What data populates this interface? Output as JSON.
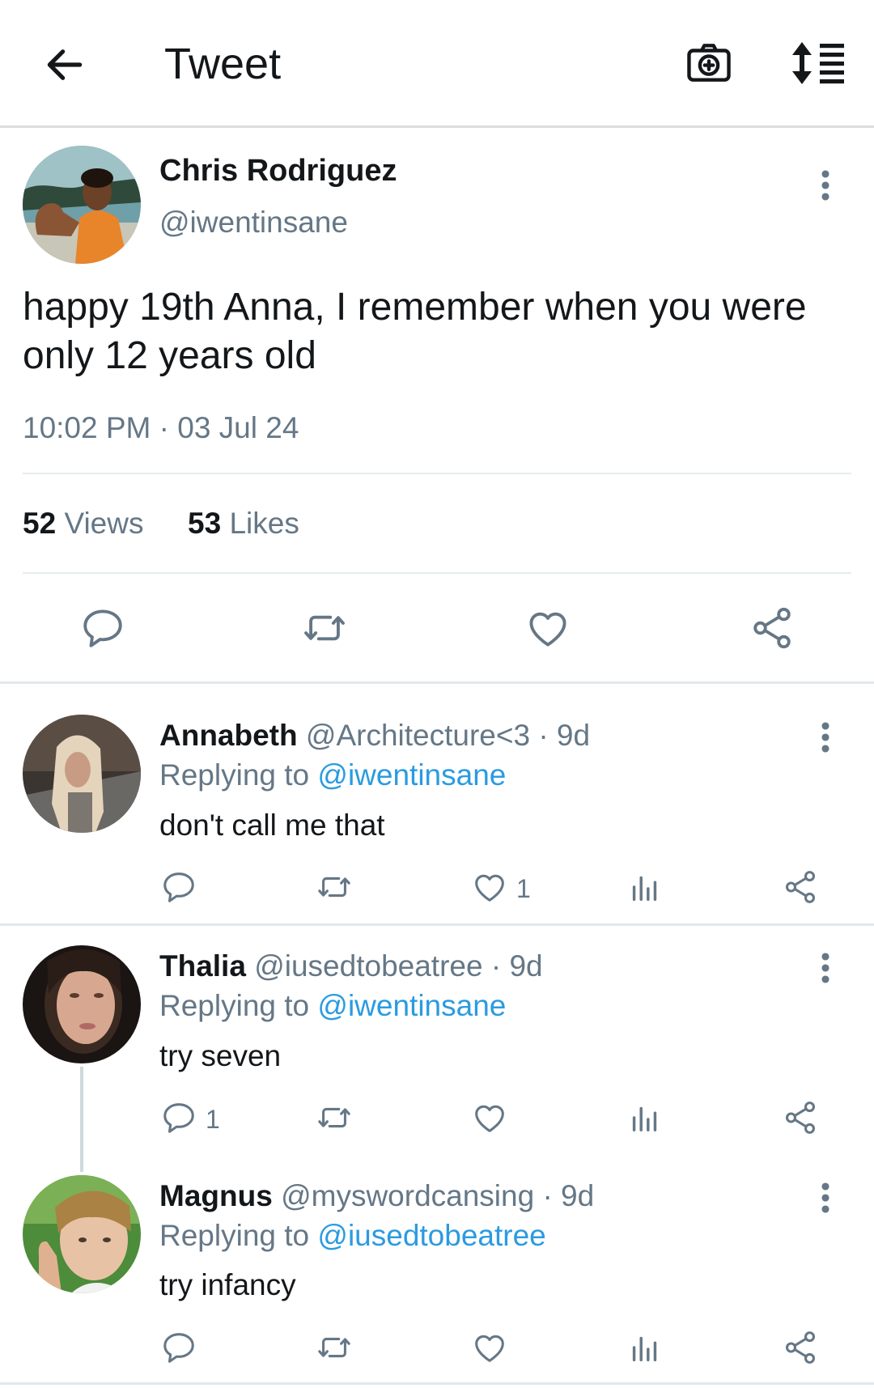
{
  "header": {
    "title": "Tweet",
    "back_icon": "arrow-left-icon",
    "camera_icon": "camera-plus-icon",
    "sort_icon": "sort-list-icon"
  },
  "tweet": {
    "author_name": "Chris Rodriguez",
    "author_handle": "@iwentinsane",
    "text": "happy 19th Anna, I remember when you were only 12 years old",
    "timestamp": "10:02 PM · 03 Jul 24",
    "views_count": "52",
    "views_label": "Views",
    "likes_count": "53",
    "likes_label": "Likes"
  },
  "replies": [
    {
      "name": "Annabeth",
      "meta": "@Architecture<3 · 9d",
      "replying_prefix": "Replying to",
      "replying_to": "@iwentinsane",
      "text": "don't call me that",
      "reply_count": "",
      "like_count": "1"
    },
    {
      "name": "Thalia",
      "meta": "@iusedtobeatree · 9d",
      "replying_prefix": "Replying to",
      "replying_to": "@iwentinsane",
      "text": "try seven",
      "reply_count": "1",
      "like_count": ""
    },
    {
      "name": "Magnus",
      "meta": "@myswordcansing · 9d",
      "replying_prefix": "Replying to",
      "replying_to": "@iusedtobeatree",
      "text": "try infancy",
      "reply_count": "",
      "like_count": ""
    }
  ],
  "colors": {
    "text": "#14171a",
    "secondary": "#657786",
    "link": "#2b9be0",
    "divider": "#e1e8ed"
  }
}
